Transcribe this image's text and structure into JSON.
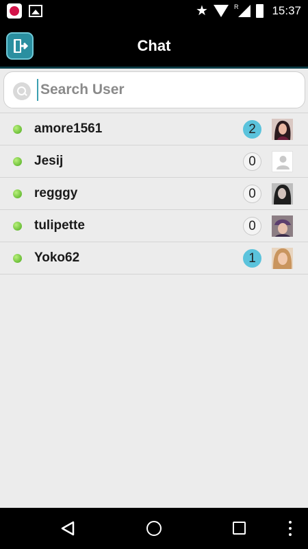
{
  "status_bar": {
    "time": "15:37",
    "left_icons": [
      "notification-app-icon",
      "image-icon"
    ],
    "right_icons": [
      "star-icon",
      "wifi-icon",
      "signal-icon",
      "battery-charging-icon"
    ],
    "roaming_indicator": "R"
  },
  "app_bar": {
    "title": "Chat",
    "left_button_icon": "logout-icon"
  },
  "search": {
    "placeholder": "Search User",
    "value": ""
  },
  "users": [
    {
      "name": "amore1561",
      "unread": "2",
      "online": true,
      "avatar": "photo"
    },
    {
      "name": "Jesij",
      "unread": "0",
      "online": true,
      "avatar": "placeholder"
    },
    {
      "name": "regggy",
      "unread": "0",
      "online": true,
      "avatar": "photo"
    },
    {
      "name": "tulipette",
      "unread": "0",
      "online": true,
      "avatar": "photo"
    },
    {
      "name": "Yoko62",
      "unread": "1",
      "online": true,
      "avatar": "photo"
    }
  ],
  "colors": {
    "accent": "#2a8fa0",
    "unread_badge": "#5bc3dc",
    "online": "#4caa1c",
    "background": "#ececec"
  },
  "nav_bar": {
    "icons": [
      "back-icon",
      "home-icon",
      "recents-icon",
      "overflow-menu-icon"
    ]
  }
}
